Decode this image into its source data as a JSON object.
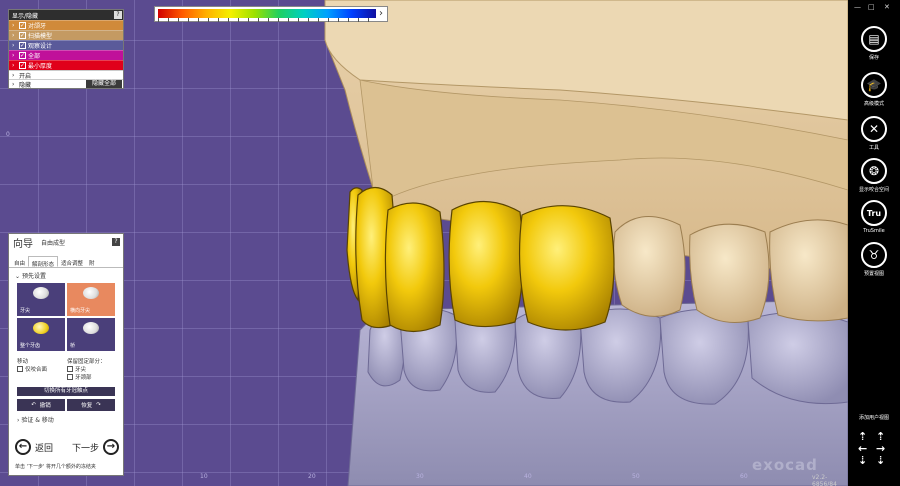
{
  "display_panel": {
    "title": "显示/隐藏",
    "help": "?",
    "rows": [
      {
        "label": "对颌牙",
        "color": "#d08a3a"
      },
      {
        "label": "扫描模型",
        "color": "#c49a62"
      },
      {
        "label": "观察设计",
        "color": "#5a5a9a"
      },
      {
        "label": "全部",
        "color": "#c0109a"
      },
      {
        "label": "最小厚度",
        "color": "#e0001a"
      }
    ],
    "open_label": "开启",
    "hide_label": "隐藏",
    "hide_all_button": "隐藏全部"
  },
  "colorbar": {
    "arrow": "›"
  },
  "wizard": {
    "title": "向导",
    "subtitle": "自由成型",
    "help": "?",
    "tabs": [
      "自由",
      "解剖形态",
      "适合调整",
      "附"
    ],
    "active_tab": 1,
    "section_label": "预先设置",
    "tools": [
      {
        "label": "牙尖",
        "selected": false
      },
      {
        "label": "横向牙尖",
        "selected": true
      },
      {
        "label": "整个牙齿",
        "selected": false
      },
      {
        "label": "桥",
        "selected": false
      }
    ],
    "move_label": "移动",
    "move_option": "仅咬合面",
    "keep_label": "保留固定部分：",
    "keep_options": [
      "牙尖",
      "牙颈部"
    ],
    "reset_button": "切换所有牙冠触点",
    "undo_label": "撤销",
    "redo_label": "恢复",
    "collapse_label": "验证 & 移动",
    "back_label": "返回",
    "next_label": "下一步",
    "hint": "单击 '下一步' 将开几个额外的冻结夹"
  },
  "toolbar": {
    "window_controls": [
      "—",
      "□",
      "✕"
    ],
    "items": [
      {
        "label": "保存",
        "icon": "save-icon",
        "glyph": "▤"
      },
      {
        "label": "高级模式",
        "icon": "graduation-cap-icon",
        "glyph": "🎓"
      },
      {
        "label": "工具",
        "icon": "tools-icon",
        "glyph": "✕"
      },
      {
        "label": "显示咬合空间",
        "icon": "occlusion-icon",
        "glyph": "❂"
      },
      {
        "label": "TruSmile",
        "icon": "trusmile-icon",
        "glyph": "Tru"
      },
      {
        "label": "预置视图",
        "icon": "tooth-view-icon",
        "glyph": "♉"
      }
    ],
    "add_view_label": "添加用户视图"
  },
  "viewport": {
    "watermark": "exocad",
    "version": "v2.2-6856/84",
    "axis_ticks": [
      "0",
      "10",
      "20",
      "30",
      "40",
      "50",
      "60",
      "70"
    ]
  }
}
